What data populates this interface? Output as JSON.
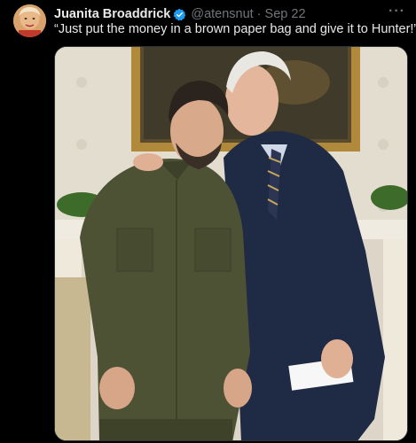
{
  "tweet": {
    "display_name": "Juanita Broaddrick",
    "handle": "@atensnut",
    "separator": "·",
    "date": "Sep 22",
    "text": "“Just put the money in a brown paper bag and give it to Hunter!”",
    "more_label": "···"
  },
  "colors": {
    "background": "#000000",
    "name_text": "#e7e9ea",
    "secondary_text": "#71767b",
    "verified_badge": "#1d9bf0"
  },
  "icons": {
    "verified": "verified-badge-icon",
    "more": "more-options-icon"
  }
}
